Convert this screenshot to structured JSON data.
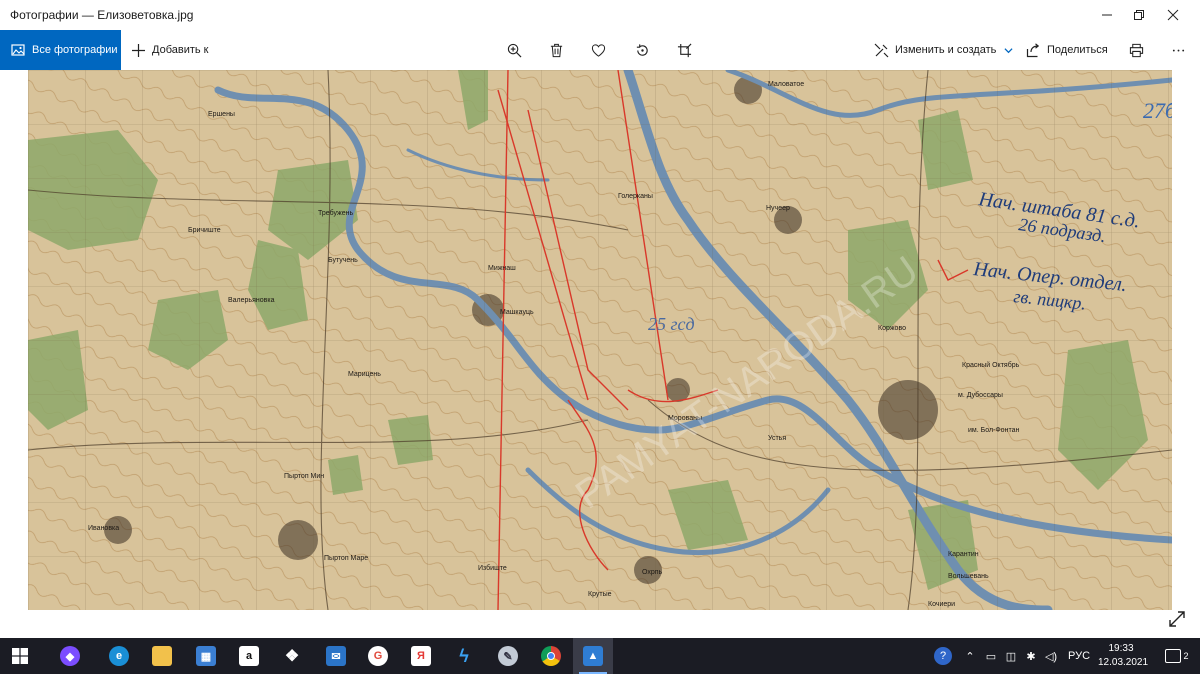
{
  "window": {
    "title": "Фотографии — Елизоветовка.jpg",
    "controls": [
      "minimize",
      "maximize",
      "close"
    ]
  },
  "toolbar": {
    "all_photos": "Все фотографии",
    "add_to": "Добавить к",
    "edit_create": "Изменить и создать",
    "share": "Поделиться",
    "center_icons": [
      "zoom-icon",
      "delete-icon",
      "favorite-icon",
      "rotate-icon",
      "crop-icon"
    ],
    "right_icons": [
      "print-icon",
      "more-icon"
    ]
  },
  "map": {
    "description_labels": [
      "Маловатое",
      "Ершены",
      "Голерканы",
      "Бричиште",
      "Требужень",
      "Бутучень",
      "Валерьяновка",
      "Мижнаш",
      "Машкауць",
      "Марицень",
      "Морованы",
      "Пыртоп Мин",
      "Ивановка",
      "Пыртоп Маре",
      "Избиште",
      "Охрпь",
      "Крутые",
      "Нучеер",
      "Коржово",
      "Красный Октябрь",
      "м. Дубоссары",
      "им. Бол-Фонтан",
      "Устья",
      "Карантин",
      "Вольшевань",
      "Кочиери"
    ],
    "handwritten": [
      "Нач. штаба 81 с. д.",
      "26 подразд.",
      "Нач. Опер. отдел.",
      "гв. пицкр.",
      "25 гсд",
      "27б"
    ]
  },
  "taskbar": {
    "apps": [
      "start",
      "alice",
      "edge",
      "explorer",
      "store",
      "amazon",
      "dropbox",
      "mail",
      "chrome-alt",
      "yandex",
      "vscode",
      "paint",
      "chrome",
      "photos"
    ],
    "lang": "РУС",
    "time": "19:33",
    "date": "12.03.2021",
    "notification_count": "2"
  },
  "colors": {
    "accent": "#0067c0",
    "taskbar": "#1b1c24",
    "map_base": "#d8c39a",
    "river": "#6f8fb0",
    "forest": "#8ea86a",
    "route": "#d9382a"
  }
}
